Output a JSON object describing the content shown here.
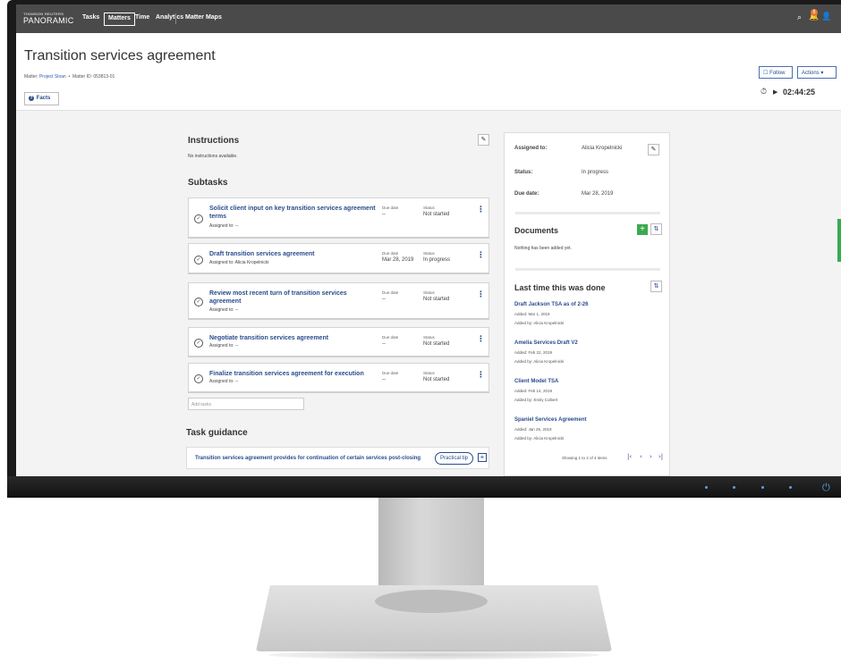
{
  "nav": {
    "brand_top": "THOMSON REUTERS",
    "brand_name": "PANORAMIC",
    "items": [
      "Tasks",
      "Matters",
      "Time",
      "Analytics",
      "Matter Maps"
    ],
    "notification_count": "8"
  },
  "header": {
    "title": "Transition services agreement",
    "matter_prefix": "Matter:",
    "matter_name": "Project Sloan",
    "matter_id": "Matter ID: 053813-01",
    "facts_label": "Facts",
    "follow_label": "Follow",
    "actions_label": "Actions",
    "timer": "02:44:25"
  },
  "instructions": {
    "title": "Instructions",
    "text": "No instructions available."
  },
  "subtasks": {
    "title": "Subtasks",
    "due_label": "Due date",
    "status_label": "Status",
    "items": [
      {
        "title": "Solicit client input on key transition services agreement terms",
        "assigned": "Assigned to: --",
        "due": "--",
        "status": "Not started"
      },
      {
        "title": "Draft transition services agreement",
        "assigned": "Assigned to: Alicia Kropelnicki",
        "due": "Mar 28, 2019",
        "status": "In progress"
      },
      {
        "title": "Review most recent turn of transition services agreement",
        "assigned": "Assigned to: --",
        "due": "--",
        "status": "Not started"
      },
      {
        "title": "Negotiate transition services agreement",
        "assigned": "Assigned to: --",
        "due": "--",
        "status": "Not started"
      },
      {
        "title": "Finalize transition services agreement for execution",
        "assigned": "Assigned to: --",
        "due": "--",
        "status": "Not started"
      }
    ],
    "add_placeholder": "Add tasks"
  },
  "guidance": {
    "title": "Task guidance",
    "text": "Transition services agreement provides for continuation of certain services post-closing",
    "tip_label": "Practical tip"
  },
  "details": {
    "assigned_label": "Assigned to:",
    "assigned_value": "Alicia Kropelnicki",
    "status_label": "Status:",
    "status_value": "In progress",
    "due_label": "Due date:",
    "due_value": "Mar 28, 2019"
  },
  "documents": {
    "title": "Documents",
    "empty_text": "Nothing has been added yet."
  },
  "history": {
    "title": "Last time this was done",
    "items": [
      {
        "title": "Draft Jackson TSA as of 2-26",
        "added": "Added: Mar 1, 2019",
        "by": "Added by: Alicia Kropelnicki"
      },
      {
        "title": "Amelia Services Draft V2",
        "added": "Added: Feb 22, 2019",
        "by": "Added by: Alicia Kropelnicki"
      },
      {
        "title": "Client Model TSA",
        "added": "Added: Feb 14, 2019",
        "by": "Added by: Emily Colbert"
      },
      {
        "title": "Spaniel Services Agreement",
        "added": "Added: Jan 26, 2019",
        "by": "Added by: Alicia Kropelnicki"
      }
    ],
    "pager_text": "Showing 1 to 4 of 4 items"
  },
  "colors": {
    "nav_bg": "#4a4a4a",
    "link": "#2a4c8c",
    "accent_green": "#3aaa4f",
    "badge": "#e8772e"
  }
}
